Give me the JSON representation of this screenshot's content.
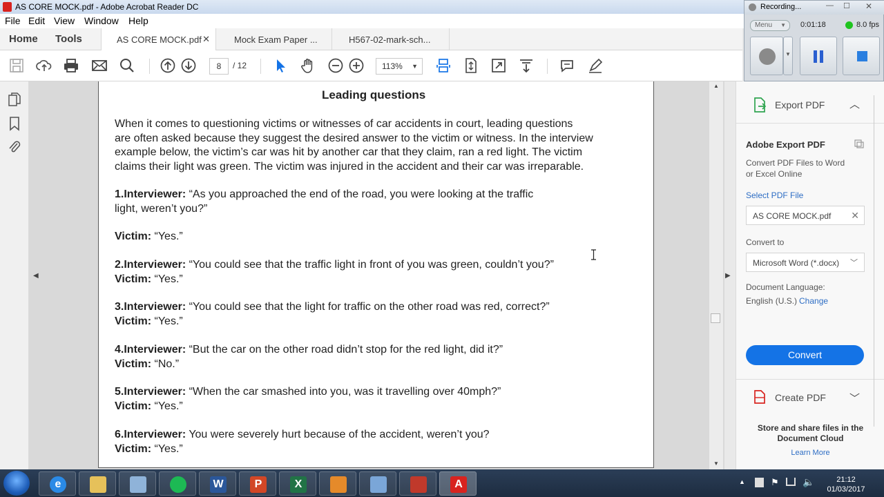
{
  "window": {
    "title": "AS CORE MOCK.pdf - Adobe Acrobat Reader DC"
  },
  "menu": [
    "File",
    "Edit",
    "View",
    "Window",
    "Help"
  ],
  "nav": {
    "home": "Home",
    "tools": "Tools"
  },
  "tabs": [
    {
      "label": "AS CORE MOCK.pdf",
      "close": "✕"
    },
    {
      "label": "Mock Exam Paper ..."
    },
    {
      "label": "H567-02-mark-sch..."
    }
  ],
  "toolbar": {
    "page_current": "8",
    "page_total": "/ 12",
    "zoom": "113%"
  },
  "document": {
    "heading": "Leading questions",
    "intro": [
      "When it comes to questioning victims or witnesses of car accidents in court, leading questions",
      "are often asked because they suggest the desired answer to the victim or witness. In the interview",
      "example below, the victim’s car was hit by another car that they claim, ran a red light. The victim",
      "claims their light was green. The victim was injured in the accident and their car was irreparable."
    ],
    "q1": {
      "speaker": "1.Interviewer:",
      "line1": " “As you approached the end of the road, you were looking at the traffic",
      "line2": "light, weren’t you?”"
    },
    "a1": {
      "speaker": "Victim:",
      "text": " “Yes.”"
    },
    "q2": {
      "speaker": "2.Interviewer:",
      "text": " “You could see that the traffic light in front of you was green, couldn’t you?”"
    },
    "a2": {
      "speaker": "Victim:",
      "text": " “Yes.”"
    },
    "q3": {
      "speaker": "3.Interviewer:",
      "text": " “You could see that the light for traffic on the other road was red, correct?”"
    },
    "a3": {
      "speaker": "Victim:",
      "text": " “Yes.”"
    },
    "q4": {
      "speaker": "4.Interviewer:",
      "text": " “But the car on the other road didn’t stop for the red light, did it?”"
    },
    "a4": {
      "speaker": "Victim:",
      "text": " “No.”"
    },
    "q5": {
      "speaker": "5.Interviewer:",
      "text": " “When the car smashed into you, was it travelling over 40mph?”"
    },
    "a5": {
      "speaker": "Victim:",
      "text": " “Yes.”"
    },
    "q6": {
      "speaker": "6.Interviewer:",
      "text": " You were severely hurt because of the accident, weren’t you?"
    },
    "a6": {
      "speaker": "Victim:",
      "text": " “Yes.”"
    }
  },
  "right_pane": {
    "export_title": "Export PDF",
    "adobe_export": "Adobe Export PDF",
    "desc_line1": "Convert PDF Files to Word",
    "desc_line2": "or Excel Online",
    "select_file": "Select PDF File",
    "file_name": "AS CORE MOCK.pdf",
    "convert_to": "Convert to",
    "format": "Microsoft Word (*.docx)",
    "doc_language": "Document Language:",
    "language": "English (U.S.)",
    "change": "Change",
    "convert_button": "Convert",
    "create_pdf": "Create PDF",
    "store_line1": "Store and share files in the",
    "store_line2": "Document Cloud",
    "learn_more": "Learn More"
  },
  "recorder": {
    "title": "Recording...",
    "menu": "Menu",
    "time": "0:01:18",
    "fps": "8.0 fps"
  },
  "taskbar": {
    "time": "21:12",
    "date": "01/03/2017"
  },
  "colors": {
    "accent": "#1473e6",
    "link": "#2d6dc4",
    "acrobat_red": "#d8231f"
  }
}
